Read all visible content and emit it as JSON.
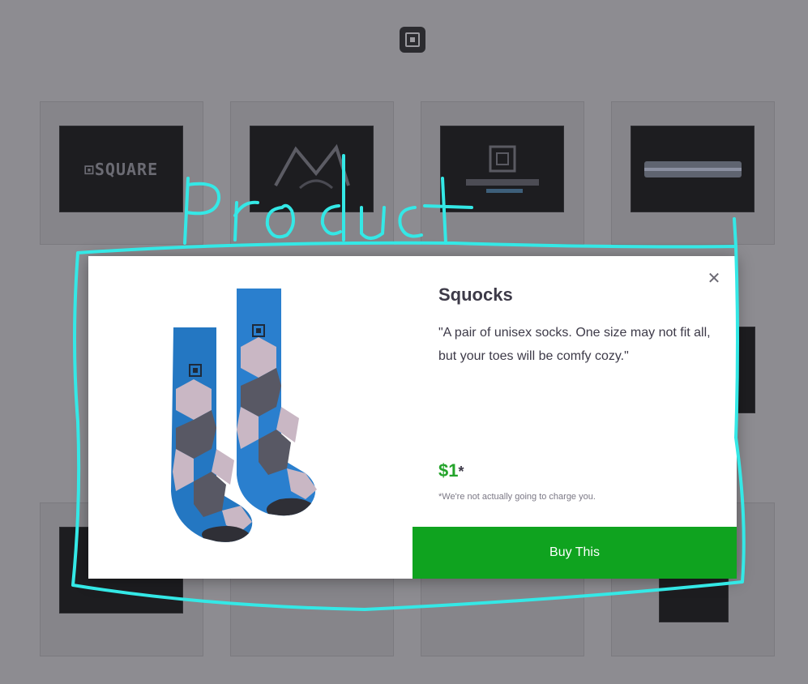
{
  "header": {
    "logo_icon": "square-logo-icon"
  },
  "grid": {
    "thumbs": [
      {
        "label": "⊡SQUARE"
      },
      {
        "label": ""
      },
      {
        "label": ""
      },
      {
        "label": ""
      },
      {
        "label": ""
      }
    ]
  },
  "modal": {
    "title": "Squocks",
    "description": "\"A pair of unisex socks. One size may not fit all, but your toes will be comfy cozy.\"",
    "price": "$1",
    "price_marker": "*",
    "note": "*We're not actually going to charge you.",
    "buy_label": "Buy This",
    "close_icon": "close-icon"
  },
  "annotation": {
    "label": "Product",
    "color": "#34e8e6"
  },
  "colors": {
    "buy_button": "#0fa31f",
    "price": "#24a42b",
    "backdrop": "#8d8c91"
  }
}
